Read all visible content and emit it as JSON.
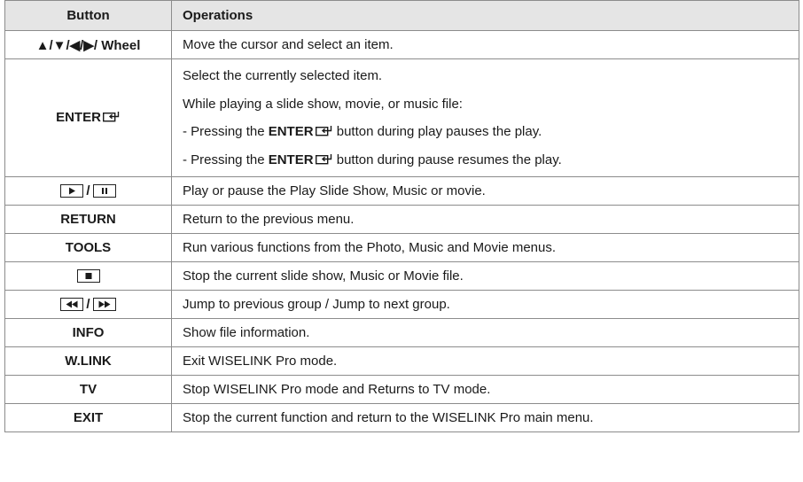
{
  "headers": {
    "button": "Button",
    "operations": "Operations"
  },
  "rows": [
    {
      "button_text": "▲/▼/◀/▶/ Wheel",
      "operation": "Move the cursor and select an item."
    },
    {
      "button_text": "ENTER",
      "button_icon": "enter-icon",
      "operation_lines": {
        "line1": "Select the currently selected item.",
        "line2": "While playing a slide show, movie, or music file:",
        "line3_prefix": "- Pressing the ",
        "line3_bold": "ENTER",
        "line3_suffix": " button during play pauses the play.",
        "line4_prefix": "- Pressing the ",
        "line4_bold": "ENTER",
        "line4_suffix": " button during pause resumes the play."
      }
    },
    {
      "button_icons": [
        "play-key-icon",
        "pause-key-icon"
      ],
      "separator": "/",
      "operation": "Play or pause the Play Slide Show, Music or movie."
    },
    {
      "button_text": "RETURN",
      "operation": "Return to the previous menu."
    },
    {
      "button_text": "TOOLS",
      "operation": "Run various functions from the Photo, Music and Movie menus."
    },
    {
      "button_icons": [
        "stop-key-icon"
      ],
      "operation": "Stop the current slide show, Music or Movie file."
    },
    {
      "button_icons": [
        "rewind-key-icon",
        "fast-forward-key-icon"
      ],
      "separator": "/",
      "operation": "Jump to previous group / Jump to next group."
    },
    {
      "button_text": "INFO",
      "operation": "Show file information."
    },
    {
      "button_text": "W.LINK",
      "operation": "Exit WISELINK Pro mode."
    },
    {
      "button_text": "TV",
      "operation": "Stop WISELINK Pro mode and Returns to TV mode."
    },
    {
      "button_text": "EXIT",
      "operation": "Stop the current function and return to the WISELINK Pro main menu."
    }
  ],
  "colors": {
    "header_bg": "#e5e5e5",
    "border": "#8c8c8c",
    "text": "#1a1a1a"
  }
}
